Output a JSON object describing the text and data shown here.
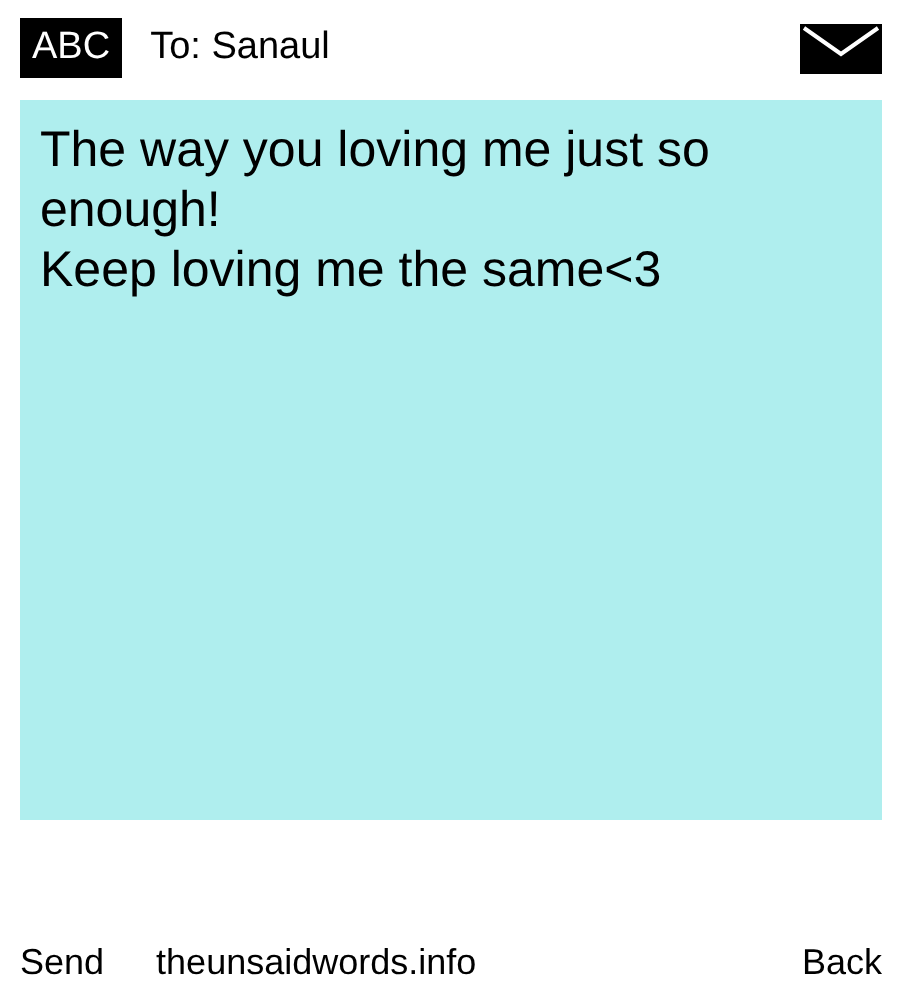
{
  "header": {
    "badge": "ABC",
    "recipient": "To: Sanaul"
  },
  "message": {
    "lines": [
      "The way you loving me just so enough!",
      "Keep loving me the same<3"
    ]
  },
  "footer": {
    "left": "Send",
    "center": "theunsaidwords.info",
    "right": "Back"
  }
}
